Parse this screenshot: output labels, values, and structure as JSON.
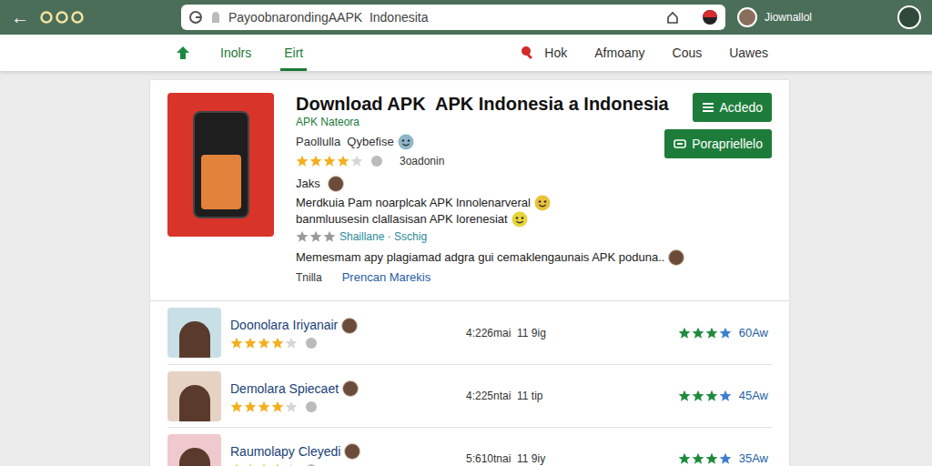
{
  "toolbar": {
    "back": "←",
    "url": "PayoobnarondingAAPK  Indonesita",
    "user": "Jiownallol"
  },
  "nav": {
    "tabs": [
      {
        "label": "Inolrs",
        "selected": false
      },
      {
        "label": "Eirt",
        "selected": true
      }
    ],
    "links": [
      "Hok",
      "Afmoany",
      "Cous",
      "Uawes"
    ]
  },
  "app": {
    "title": "Download APK  APK Indonesia a Indonesia",
    "publisher": "APK Nateora",
    "byline": "Paollulla  Qybefise",
    "stars": 4,
    "rating_text": "3oadonin",
    "tag": "Jaks",
    "description": [
      "Merdkuia Pam noarplcak APK lnnolenarveral",
      "banmluusesin clallasisan APK lorenesiat"
    ],
    "sub_stars": 3,
    "sub_links": "Shaillane · Sschig",
    "summary": "Memesmam apy plagiamad adgra gui cemaklengaunais APK poduna..",
    "footer_label": "Tnilla",
    "footer_link": "Prencan Marekis",
    "buttons": [
      "Acdedo",
      "Porapriellelo"
    ]
  },
  "reviews": [
    {
      "name": "Doonolara Iriyanair",
      "stars": 4,
      "meta": "4:226mai  11 9ig",
      "rating": 3,
      "count": "60Aw"
    },
    {
      "name": "Demolara Spiecaet",
      "stars": 4,
      "meta": "4:225ntai  11 tip",
      "rating": 3,
      "count": "45Aw"
    },
    {
      "name": "Raumolapy Cleyedi",
      "stars": 4,
      "meta": "5:610tnai  11 9iy",
      "rating": 3,
      "count": "35Aw"
    }
  ]
}
